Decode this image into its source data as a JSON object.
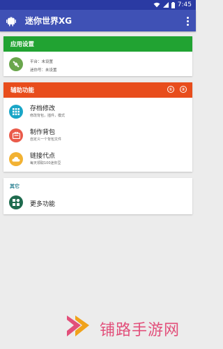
{
  "status": {
    "time": "7:45"
  },
  "appbar": {
    "title": "迷你世界XG"
  },
  "cards": {
    "settings": {
      "header": "应用设置",
      "platform_label": "平台：未设置",
      "account_label": "迷你号：未设置"
    },
    "assist": {
      "header": "辅助功能",
      "header_icons": [
        "①",
        "②"
      ],
      "items": [
        {
          "title": "存档修改",
          "subtitle": "修改背包，插件，模式"
        },
        {
          "title": "制作背包",
          "subtitle": "自定义一个背包文件"
        },
        {
          "title": "链接代点",
          "subtitle": "每天领取100迷你豆"
        }
      ]
    },
    "other": {
      "header": "其它",
      "items": [
        {
          "title": "更多功能"
        }
      ]
    }
  },
  "watermark": {
    "text": "铺路手游网"
  },
  "colors": {
    "primary": "#3f51b5",
    "status": "#2a3aa3",
    "green": "#21a332",
    "orange": "#e84d1c",
    "teal_icon": "#1aa6c7",
    "red_icon": "#ea5a4a",
    "yellow_icon": "#f2b233",
    "dark_green_icon": "#1f6b4e"
  }
}
